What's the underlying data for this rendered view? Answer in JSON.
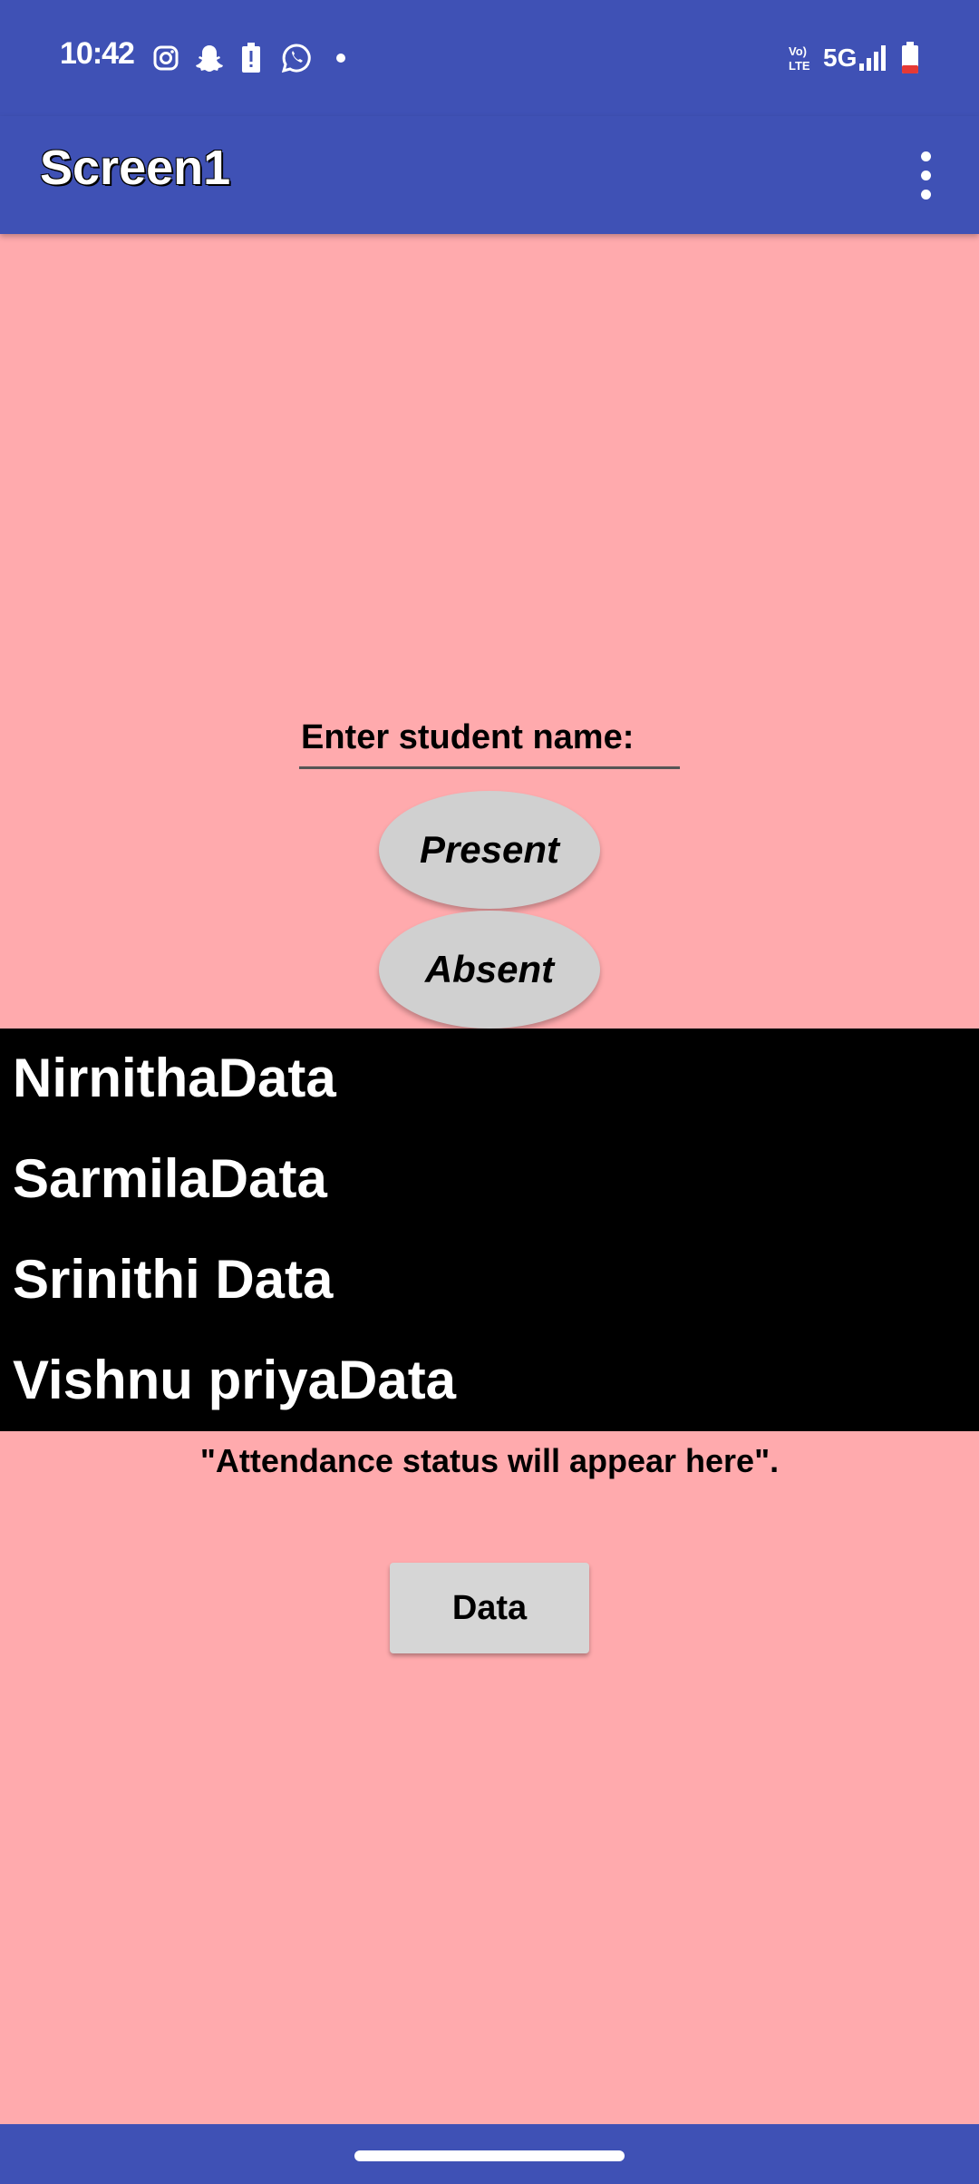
{
  "status_bar": {
    "time": "10:42",
    "icons_left": [
      "instagram-icon",
      "snapchat-icon",
      "battery-alert-icon",
      "whatsapp-icon",
      "notification-dot-icon"
    ],
    "network_label": "5G",
    "volte_label": "Vo) LTE",
    "battery_color": "#e53935"
  },
  "app_bar": {
    "title": "Screen1",
    "menu_icon": "more-vert-icon"
  },
  "form": {
    "name_placeholder": "Enter student name:",
    "present_label": "Present",
    "absent_label": "Absent"
  },
  "list": {
    "items": [
      "NirnithaData",
      "SarmilaData",
      "Srinithi Data",
      "Vishnu priyaData"
    ]
  },
  "status_text": "\"Attendance status will appear here\".",
  "data_button_label": "Data",
  "colors": {
    "primary": "#3f51b5",
    "background": "#ffaaad",
    "list_background": "#000000",
    "button_gray": "#d0d0d0"
  }
}
